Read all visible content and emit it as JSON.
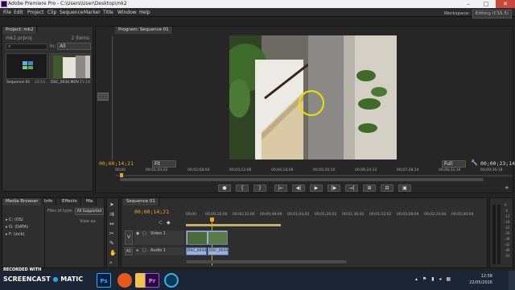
{
  "window": {
    "title": "Adobe Premiere Pro - C:\\Users\\User\\Desktop\\mk2",
    "min": "–",
    "max": "□",
    "close": "✕"
  },
  "menu": [
    "File",
    "Edit",
    "Project",
    "Clip",
    "Sequence",
    "Marker",
    "Title",
    "Window",
    "Help"
  ],
  "workspace": {
    "label": "Workspace:",
    "value": "Editing (CS5.5)"
  },
  "project": {
    "tab": "Project: mk2",
    "file": "mk2.prproj",
    "count": "2 Items",
    "in_label": "In:",
    "in_value": "All",
    "items": [
      {
        "name": "Sequence 01",
        "duration": "23:14"
      },
      {
        "name": "DSC_0034.MOV",
        "duration": "11:18"
      }
    ]
  },
  "program": {
    "tab": "Program: Sequence 01",
    "tc_left": "00;00;14;21",
    "fit": "Fit",
    "quality": "Full",
    "tc_right": "00;00;23;14",
    "ruler": [
      "00;00",
      "00;01;04;02",
      "00;02;08;04",
      "00;03;12;06",
      "00;04;16;08",
      "00;05;20;10",
      "00;06;24;12",
      "00;07;28;14",
      "00;08;32;16",
      "00;09;36;18"
    ],
    "transport": [
      "●",
      "{",
      "}",
      "|←",
      "◀|",
      "▶",
      "|▶",
      "→|",
      "⊞",
      "⊟",
      "▣"
    ]
  },
  "media_browser": {
    "tabs": [
      "Media Browser",
      "Info",
      "Effects",
      "Ma"
    ],
    "files_of_type_label": "Files of type:",
    "files_of_type": "All Supported",
    "view_as": "View as:",
    "drives": [
      "C: (OS)",
      "D: (DATA)",
      "F: (sick)"
    ]
  },
  "timeline": {
    "tab": "Sequence 01",
    "tc": "00;00;14;21",
    "ruler": [
      "00;00",
      "00;00;16;00",
      "00;00;32;00",
      "00;00;48;00",
      "00;01;04;02",
      "00;01;20;02",
      "00;01;36;02",
      "00;01;52;02",
      "00;02;08;04",
      "00;02;24;04",
      "00;02;40;04"
    ],
    "video_track": "Video 1",
    "audio_track": "Audio 1",
    "v_label": "V",
    "a_label": "A1",
    "clips": [
      "DSC_0034",
      "DSC_0034"
    ]
  },
  "meter": [
    "0",
    "-6",
    "-12",
    "-18",
    "-24",
    "-30",
    "-36",
    "-42",
    "-48",
    "-54"
  ],
  "overlay": {
    "line1": "RECORDED WITH",
    "line2a": "SCREENCAST",
    "line2b": "MATIC"
  },
  "taskbar": {
    "time": "12:58",
    "date": "22/05/2016",
    "apps": [
      "Ps",
      "Pr"
    ]
  }
}
